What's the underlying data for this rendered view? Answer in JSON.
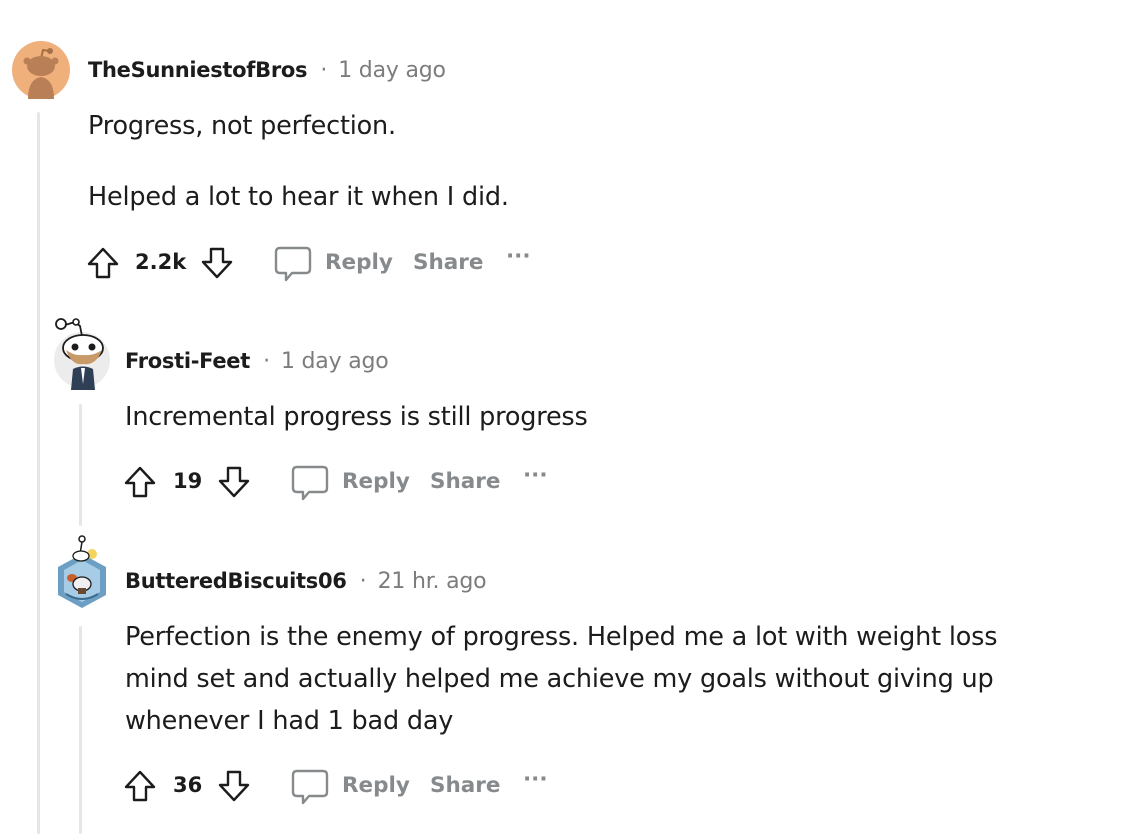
{
  "comments": [
    {
      "author": "TheSunniestofBros",
      "separator": "·",
      "time": "1 day ago",
      "paragraphs": [
        "Progress, not perfection.",
        "Helped a lot to hear it when I did."
      ],
      "votes": "2.2k",
      "reply_label": "Reply",
      "share_label": "Share",
      "more_label": "···",
      "avatar_icon": "snoo-avatar-orange-icon"
    },
    {
      "author": "Frosti-Feet",
      "separator": "·",
      "time": "1 day ago",
      "paragraphs": [
        "Incremental progress is still progress"
      ],
      "votes": "19",
      "reply_label": "Reply",
      "share_label": "Share",
      "more_label": "···",
      "avatar_icon": "snoo-avatar-suit-icon"
    },
    {
      "author": "ButteredBiscuits06",
      "separator": "·",
      "time": "21 hr. ago",
      "paragraphs": [
        "Perfection is the enemy of progress. Helped me a lot with weight loss",
        "mind set and actually helped me achieve my goals without giving up",
        "whenever I had 1 bad day"
      ],
      "votes": "36",
      "reply_label": "Reply",
      "share_label": "Share",
      "more_label": "···",
      "avatar_icon": "snoo-avatar-hex-icon"
    }
  ],
  "colors": {
    "text": "#1c1c1c",
    "meta": "#7c7c7c",
    "action": "#878a8c",
    "thread_line": "#e6e6e6",
    "avatar_orange": "#f0b07c"
  }
}
